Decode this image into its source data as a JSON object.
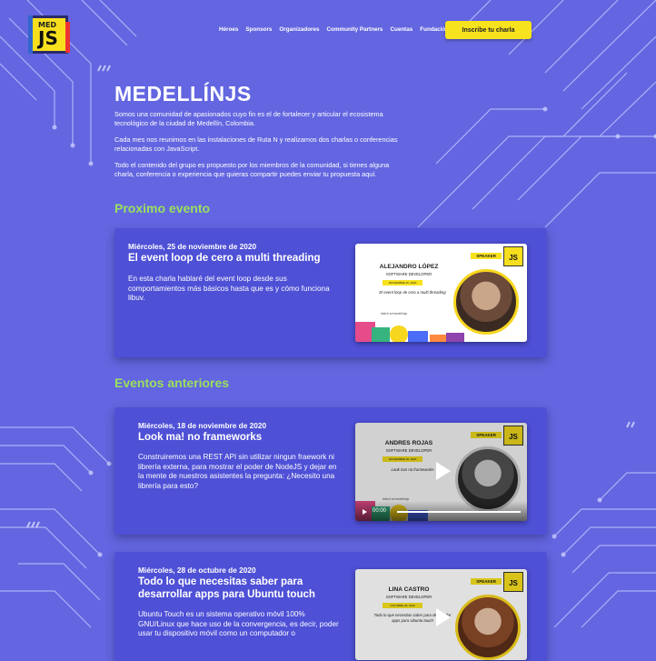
{
  "logo": {
    "med": "MED",
    "js": "JS"
  },
  "nav": [
    "Héroes",
    "Sponsors",
    "Organizadores",
    "Community Partners",
    "Cuentas",
    "Fundación"
  ],
  "cta": "Inscribe tu charla",
  "title": "MEDELLÍNJS",
  "intro": [
    "Somos una comunidad de apasionados cuyo fin es el de fortalecer y articular el ecosistema tecnológico de la ciudad de Medellín, Colombia.",
    "Cada mes nos reunimos en las instalaciones de Ruta N y realizamos dos charlas o conferencias relacionadas con JavaScript.",
    "Todo el contenido del grupo es propuesto por los miembros de la comunidad, si tienes alguna charla, conferencia o experiencia que quieras compartir puedes enviar tu propuesta aquí."
  ],
  "sections": {
    "next": "Proximo evento",
    "past": "Eventos anteriores"
  },
  "events": [
    {
      "date": "Miércoles, 25 de noviembre de 2020",
      "title": "El event loop de cero a multi threading",
      "desc": "En esta charla hablaré del event loop desde sus comportamientos más básicos hasta que es y cómo funciona libuv.",
      "speaker": "ALEJANDRO LÓPEZ",
      "role": "SOFTWARE DEVELOPER",
      "thumb_date": "NOVIEMBRE 25, 2020",
      "talk": "El event loop de cero a multi threading",
      "badge": "SPEAKER",
      "link": "twitch.tv/medellinjs"
    },
    {
      "date": "Miércoles, 18 de noviembre de 2020",
      "title": "Look ma! no frameworks",
      "desc": "Construiremos una REST API sin utilizar ningun fraework ni librería externa, para mostrar el poder de NodeJS y dejar en la mente de nuestros asistentes la pregunta: ¿Necesito una librería para esto?",
      "speaker": "ANDRES ROJAS",
      "role": "SOFTWARE DEVELOPER",
      "thumb_date": "NOVIEMBRE 18, 2020",
      "talk": "Look ma! no frameworks",
      "badge": "SPEAKER",
      "time": "00:00",
      "link": "twitch.tv/medellinjs"
    },
    {
      "date": "Miércoles, 28 de octubre de 2020",
      "title": "Todo lo que necesitas saber para desarrollar apps  para Ubuntu touch",
      "desc": "Ubuntu Touch es un sistema operativo móvil 100% GNU/Linux que hace uso de la convergencia, es decir, poder usar tu dispositivo móvil como un computador o",
      "speaker": "LINA CASTRO",
      "role": "SOFTWARE DEVELOPER",
      "thumb_date": "OCTUBRE 28, 2020",
      "talk": "Todo lo que necesitas saber para desarrollar apps para Ubuntu touch",
      "badge": "SPEAKER"
    }
  ],
  "colors": {
    "background": "#6366e0",
    "card": "#4e50d6",
    "accent_yellow": "#f7e21e",
    "accent_green": "#9be05e"
  }
}
